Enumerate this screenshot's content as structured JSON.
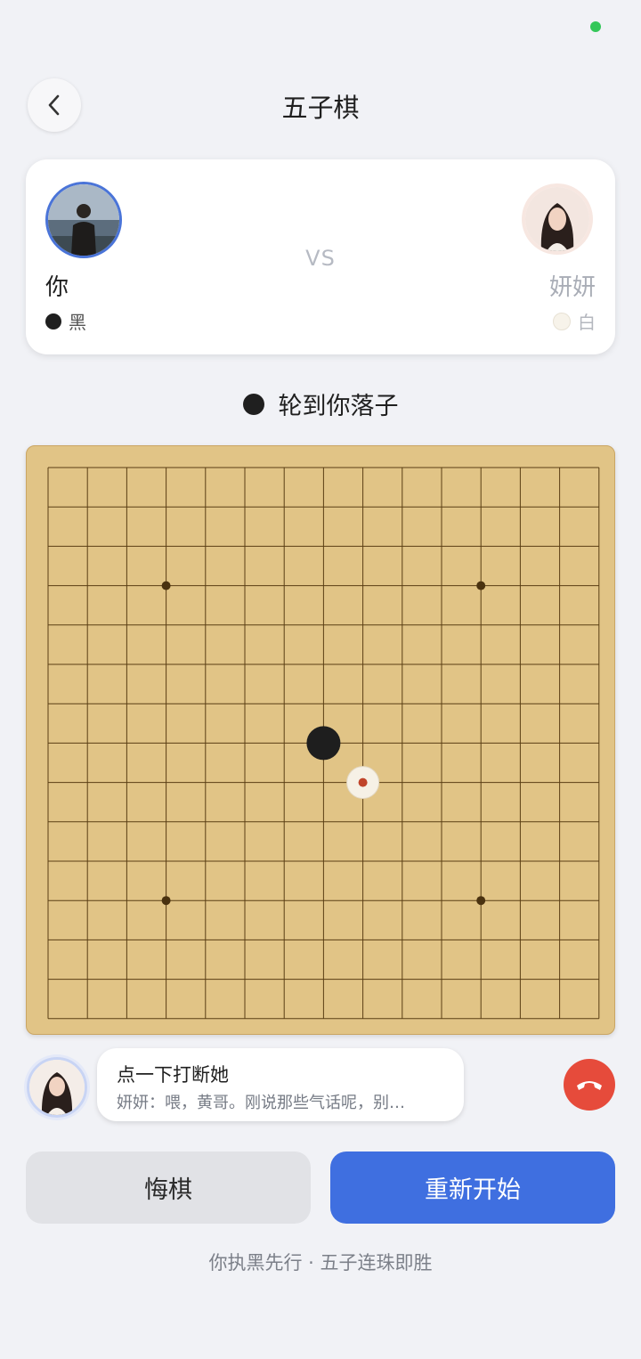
{
  "header": {
    "title": "五子棋",
    "back_icon": "chevron-left-icon"
  },
  "status": {
    "indicator_color": "#34c759"
  },
  "players": {
    "me": {
      "name": "你",
      "stone_label": "黑"
    },
    "vs_label": "VS",
    "opponent": {
      "name": "妍妍",
      "stone_label": "白"
    }
  },
  "turn": {
    "text": "轮到你落子"
  },
  "board": {
    "size": 15,
    "star_points": [
      [
        3,
        3
      ],
      [
        11,
        3
      ],
      [
        3,
        11
      ],
      [
        11,
        11
      ]
    ],
    "stones": [
      {
        "col": 7,
        "row": 7,
        "color": "black"
      },
      {
        "col": 8,
        "row": 8,
        "color": "white",
        "last_move": true
      }
    ],
    "colors": {
      "wood": "#e1c486",
      "line": "#5a3e14",
      "last_marker": "#c0442a"
    }
  },
  "call": {
    "interrupt_title": "点一下打断她",
    "interrupt_subtitle": "妍妍：喂，黄哥。刚说那些气话呢，别…",
    "hangup_icon": "phone-hangup-icon"
  },
  "actions": {
    "undo_label": "悔棋",
    "restart_label": "重新开始"
  },
  "footer": {
    "hint": "你执黑先行 · 五子连珠即胜"
  },
  "colors": {
    "accent": "#3f6fe0",
    "danger": "#e64b3b",
    "background": "#f1f2f6"
  }
}
